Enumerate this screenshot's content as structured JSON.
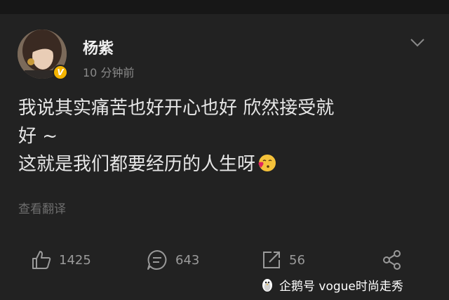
{
  "post": {
    "username": "杨紫",
    "timestamp": "10 分钟前",
    "text_lines": [
      "我说其实痛苦也好开心也好 欣然接受就",
      "好 ~",
      "这就是我们都要经历的人生呀"
    ],
    "emoji": "kiss-heart-emoji",
    "translate_label": "查看翻译"
  },
  "actions": {
    "like_count": "1425",
    "comment_count": "643",
    "repost_count": "56"
  },
  "watermark": {
    "text": "企鹅号 vogue时尚走秀"
  },
  "colors": {
    "background": "#222222",
    "verified_badge": "#f4b400",
    "muted_text": "#8a8a8a"
  },
  "icons": [
    "like-icon",
    "comment-icon",
    "repost-icon",
    "share-icon",
    "chevron-down-icon",
    "verified-icon"
  ]
}
